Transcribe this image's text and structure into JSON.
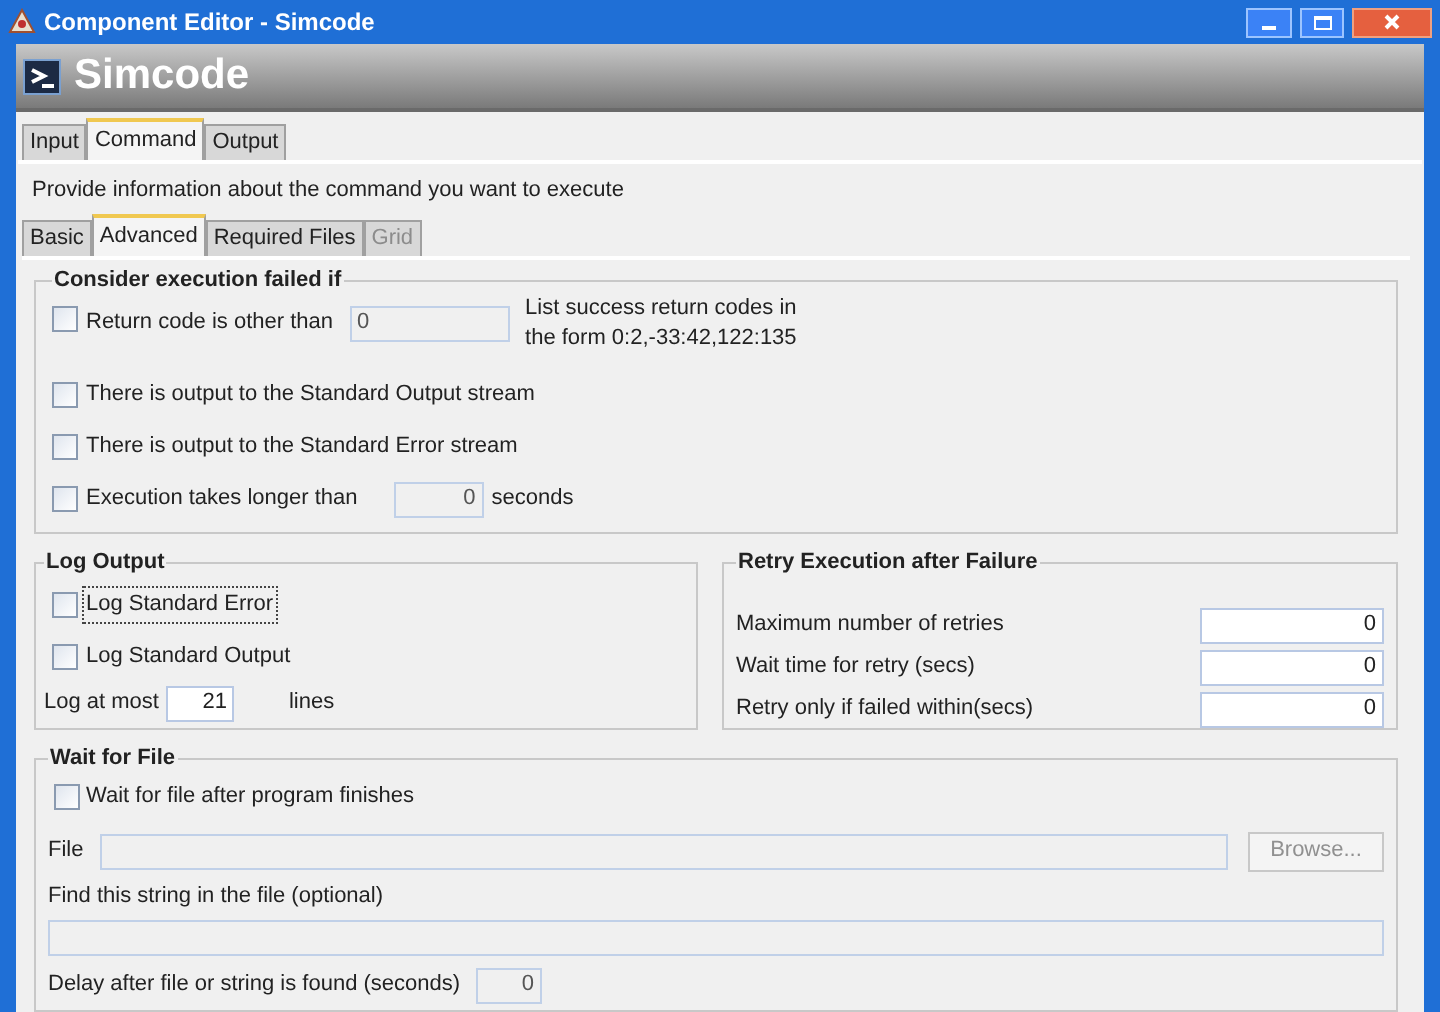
{
  "window": {
    "title": "Component Editor - Simcode"
  },
  "header": {
    "title": "Simcode"
  },
  "tabs": [
    {
      "label": "Input",
      "selected": false
    },
    {
      "label": "Command",
      "selected": true
    },
    {
      "label": "Output",
      "selected": false
    }
  ],
  "description": "Provide information about the command you want to execute",
  "subtabs": [
    {
      "label": "Basic",
      "selected": false,
      "disabled": false
    },
    {
      "label": "Advanced",
      "selected": true,
      "disabled": false
    },
    {
      "label": "Required Files",
      "selected": false,
      "disabled": false
    },
    {
      "label": "Grid",
      "selected": false,
      "disabled": true
    }
  ],
  "failure_group": {
    "title": "Consider execution failed if",
    "conditions": [
      {
        "kind": "code",
        "label": "Return code is other than",
        "checked": false,
        "value": "0",
        "disabled": true,
        "hint": "List success return codes in\nthe form 0:2,-33:42,122:135"
      },
      {
        "kind": "plain",
        "label": "There is output to the Standard Output stream",
        "checked": false
      },
      {
        "kind": "plain",
        "label": "There is output to the Standard Error stream",
        "checked": false
      },
      {
        "kind": "timeout",
        "label": "Execution takes longer than",
        "checked": false,
        "value": "0",
        "disabled": true,
        "unit": "seconds"
      }
    ]
  },
  "log_output": {
    "title": "Log Output",
    "options": [
      {
        "label": "Log Standard Error",
        "checked": false,
        "focused": true
      },
      {
        "label": "Log Standard Output",
        "checked": false,
        "focused": false
      }
    ],
    "limit": {
      "label": "Log at most",
      "value": "21",
      "unit": "lines"
    }
  },
  "retry": {
    "title": "Retry Execution after Failure",
    "fields": [
      {
        "label": "Maximum number of retries",
        "value": "0"
      },
      {
        "label": "Wait time for retry (secs)",
        "value": "0"
      },
      {
        "label": "Retry only if failed within(secs)",
        "value": "0"
      }
    ]
  },
  "wait_for_file": {
    "title": "Wait for File",
    "checkbox": {
      "label": "Wait for file after program finishes",
      "checked": false
    },
    "file": {
      "label": "File",
      "disabled": true
    },
    "browse": {
      "label": "Browse...",
      "disabled": true
    },
    "find": {
      "label": "Find this string in the file (optional)",
      "disabled": true
    },
    "delay": {
      "label": "Delay after file or string is found (seconds)",
      "value": "0",
      "disabled": true
    }
  }
}
